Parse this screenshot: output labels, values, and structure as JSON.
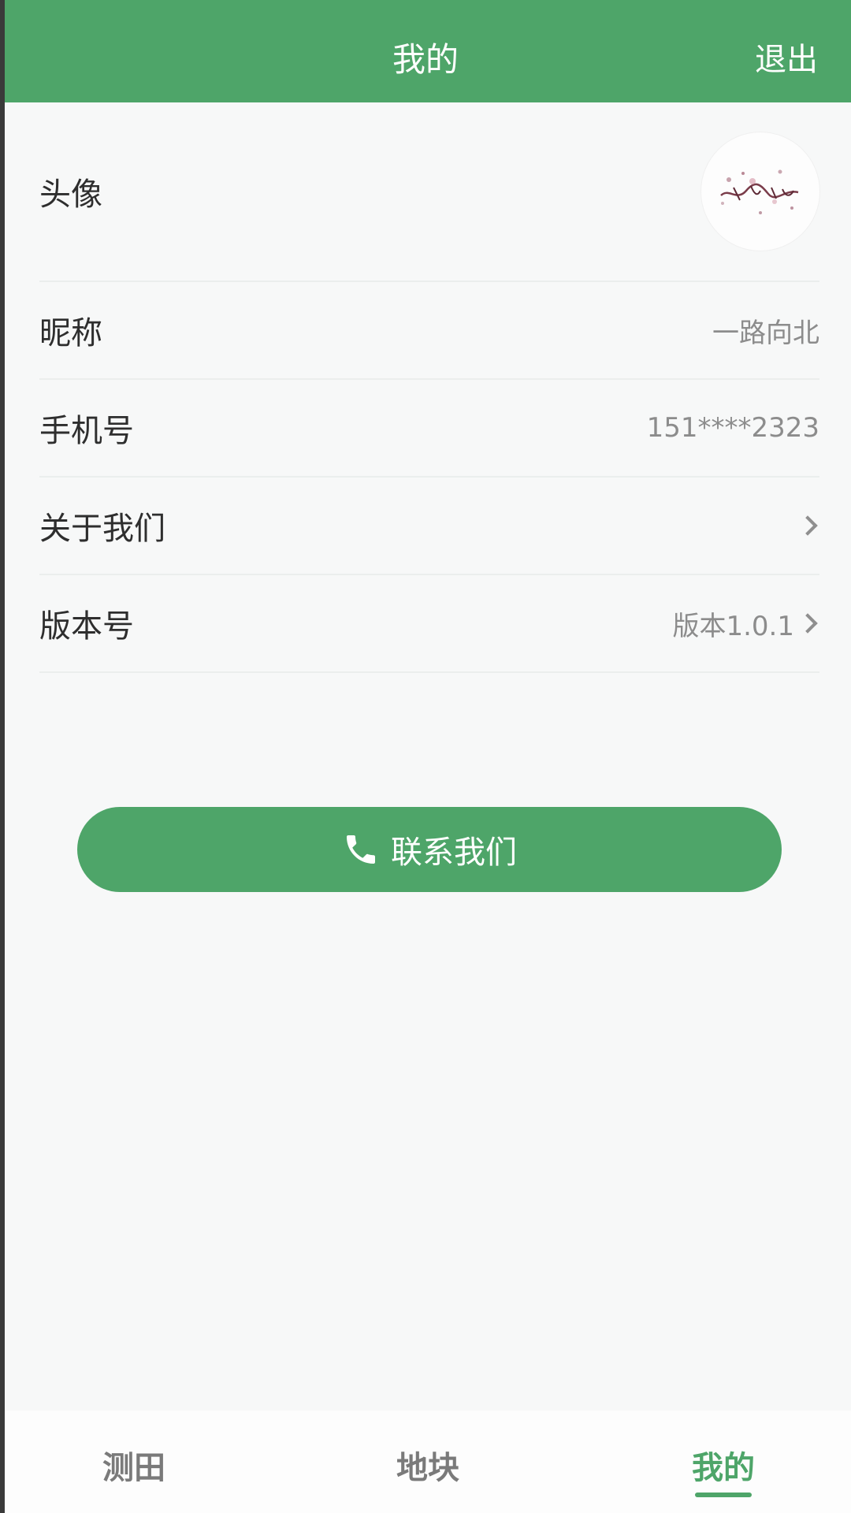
{
  "header": {
    "title": "我的",
    "logout_label": "退出"
  },
  "profile": {
    "rows": [
      {
        "label": "头像"
      },
      {
        "label": "昵称",
        "value": "一路向北"
      },
      {
        "label": "手机号",
        "value": "151****2323"
      },
      {
        "label": "关于我们"
      },
      {
        "label": "版本号",
        "value": "版本1.0.1"
      }
    ],
    "avatar_icon": "avatar-image"
  },
  "contact": {
    "label": "联系我们",
    "icon": "phone-icon"
  },
  "tabs": [
    {
      "label": "测田",
      "active": false
    },
    {
      "label": "地块",
      "active": false
    },
    {
      "label": "我的",
      "active": true
    }
  ],
  "colors": {
    "accent": "#4ea569",
    "background": "#f7f8f8",
    "muted_text": "#8c8c8c"
  }
}
